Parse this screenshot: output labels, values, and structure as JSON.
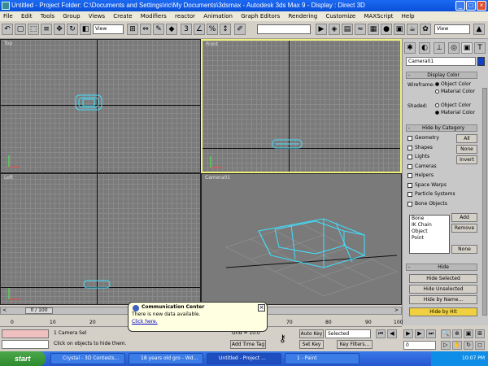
{
  "window": {
    "title": "Untitled    - Project Folder: C:\\Documents and Settings\\ric\\My Documents\\3dsmax    - Autodesk 3ds Max 9    - Display : Direct 3D"
  },
  "menu": [
    "File",
    "Edit",
    "Tools",
    "Group",
    "Views",
    "Create",
    "Modifiers",
    "reactor",
    "Animation",
    "Graph Editors",
    "Rendering",
    "Customize",
    "MAXScript",
    "Help"
  ],
  "toolbar": {
    "refcoord": "View",
    "selset": "",
    "viewsel": "View"
  },
  "viewports": {
    "top": "Top",
    "front": "Front",
    "left": "Left",
    "camera": "Camera01"
  },
  "panel": {
    "object_name": "Camera01",
    "name_color": "#1040c8",
    "display_color_title": "Display Color",
    "wireframe_label": "Wireframe:",
    "shaded_label": "Shaded:",
    "object_color": "Object Color",
    "material_color": "Material Color",
    "hide_by_category_title": "Hide by Category",
    "categories": [
      "Geometry",
      "Shapes",
      "Lights",
      "Cameras",
      "Helpers",
      "Space Warps",
      "Particle Systems",
      "Bone Objects"
    ],
    "all_btn": "All",
    "none_btn": "None",
    "invert_btn": "Invert",
    "list_items": [
      "Bone",
      "IK Chain Object",
      "Point"
    ],
    "add_btn": "Add",
    "remove_btn": "Remove",
    "none_btn2": "None",
    "hide_title": "Hide",
    "hide_selected": "Hide Selected",
    "hide_unselected": "Hide Unselected",
    "hide_by_name": "Hide by Name...",
    "hide_by_hit": "Hide by Hit",
    "hit_color": "#f0d040"
  },
  "timeline": {
    "frame": "0 / 100",
    "ticks": [
      "0",
      "10",
      "20",
      "30",
      "40",
      "50",
      "60",
      "70",
      "80",
      "90",
      "100"
    ]
  },
  "status": {
    "selection": "1 Camera Sel",
    "prompt": "Click on objects to hide them.",
    "grid": "Grid = 10.0",
    "add_time_tag": "Add Time Tag",
    "auto_key": "Auto Key",
    "set_key": "Set Key",
    "selected": "Selected",
    "key_filters": "Key Filters...",
    "frame_field": "0"
  },
  "balloon": {
    "title": "Communication Center",
    "body": "There is new data available.",
    "link": "Click here."
  },
  "taskbar": {
    "start": "start",
    "tasks": [
      "Crystal - 3D Contests...",
      "18 years old gro - Wd...",
      "Untitled   - Project ...",
      "1 - Paint"
    ],
    "clock": "10:07 PM"
  }
}
